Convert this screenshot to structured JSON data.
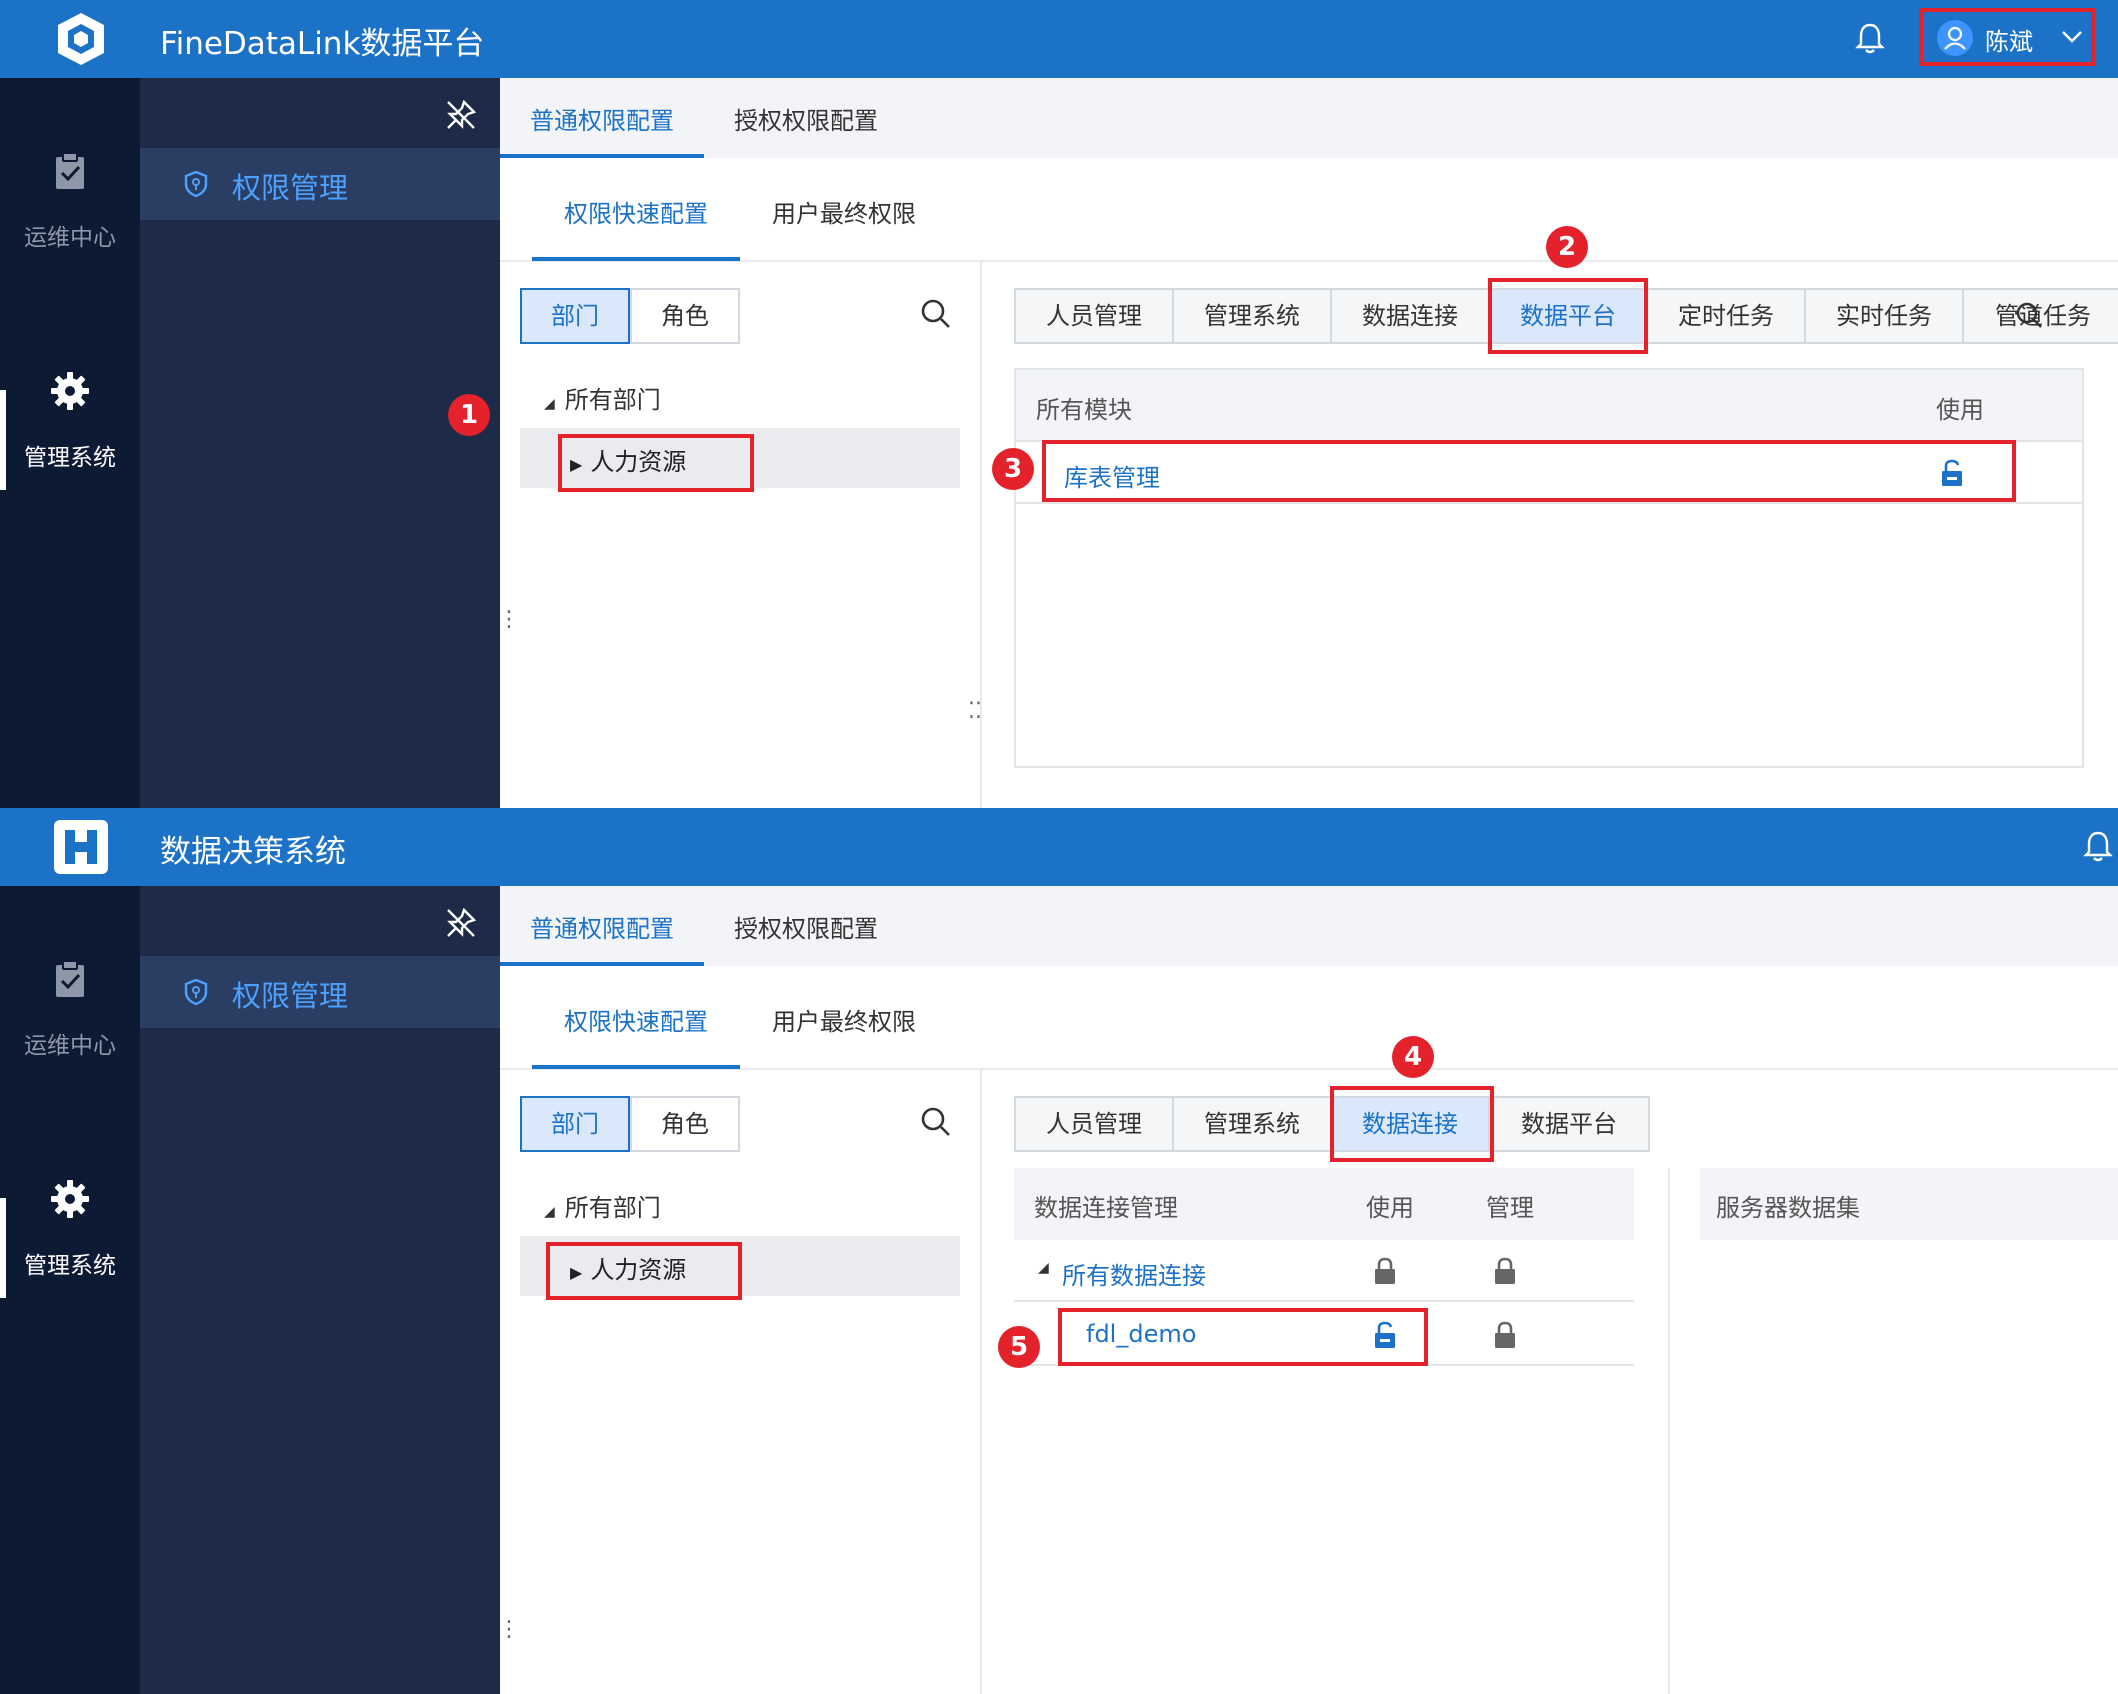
{
  "panel1": {
    "app_title": "FineDataLink数据平台",
    "user_name": "陈斌",
    "rail": [
      {
        "label": "运维中心",
        "icon": "clipboard-check-icon"
      },
      {
        "label": "管理系统",
        "icon": "gear-icon"
      }
    ],
    "sidebar_active": "权限管理",
    "top_tabs": [
      "普通权限配置",
      "授权权限配置"
    ],
    "sub_tabs": [
      "权限快速配置",
      "用户最终权限"
    ],
    "segments": [
      "部门",
      "角色"
    ],
    "tree_root": "所有部门",
    "tree_child": "人力资源",
    "module_tabs": [
      "人员管理",
      "管理系统",
      "数据连接",
      "数据平台",
      "定时任务",
      "实时任务",
      "管道任务"
    ],
    "module_table": {
      "head_module": "所有模块",
      "head_use": "使用",
      "row_name": "库表管理"
    },
    "badges": [
      "1",
      "2",
      "3"
    ]
  },
  "panel2": {
    "app_title": "数据决策系统",
    "rail": [
      {
        "label": "运维中心",
        "icon": "clipboard-check-icon"
      },
      {
        "label": "管理系统",
        "icon": "gear-icon"
      }
    ],
    "sidebar_active": "权限管理",
    "top_tabs": [
      "普通权限配置",
      "授权权限配置"
    ],
    "sub_tabs": [
      "权限快速配置",
      "用户最终权限"
    ],
    "segments": [
      "部门",
      "角色"
    ],
    "tree_root": "所有部门",
    "tree_child": "人力资源",
    "module_tabs": [
      "人员管理",
      "管理系统",
      "数据连接",
      "数据平台"
    ],
    "conn_table": {
      "head_name": "数据连接管理",
      "head_use": "使用",
      "head_manage": "管理",
      "row_all": "所有数据连接",
      "row_item": "fdl_demo"
    },
    "server_head": "服务器数据集",
    "badges": [
      "4",
      "5"
    ]
  },
  "colors": {
    "header": "#1c72c7",
    "rail": "#0d1a33",
    "sidebar": "#1d2b48",
    "accent": "#1c72c7",
    "highlight": "#e4222c"
  }
}
